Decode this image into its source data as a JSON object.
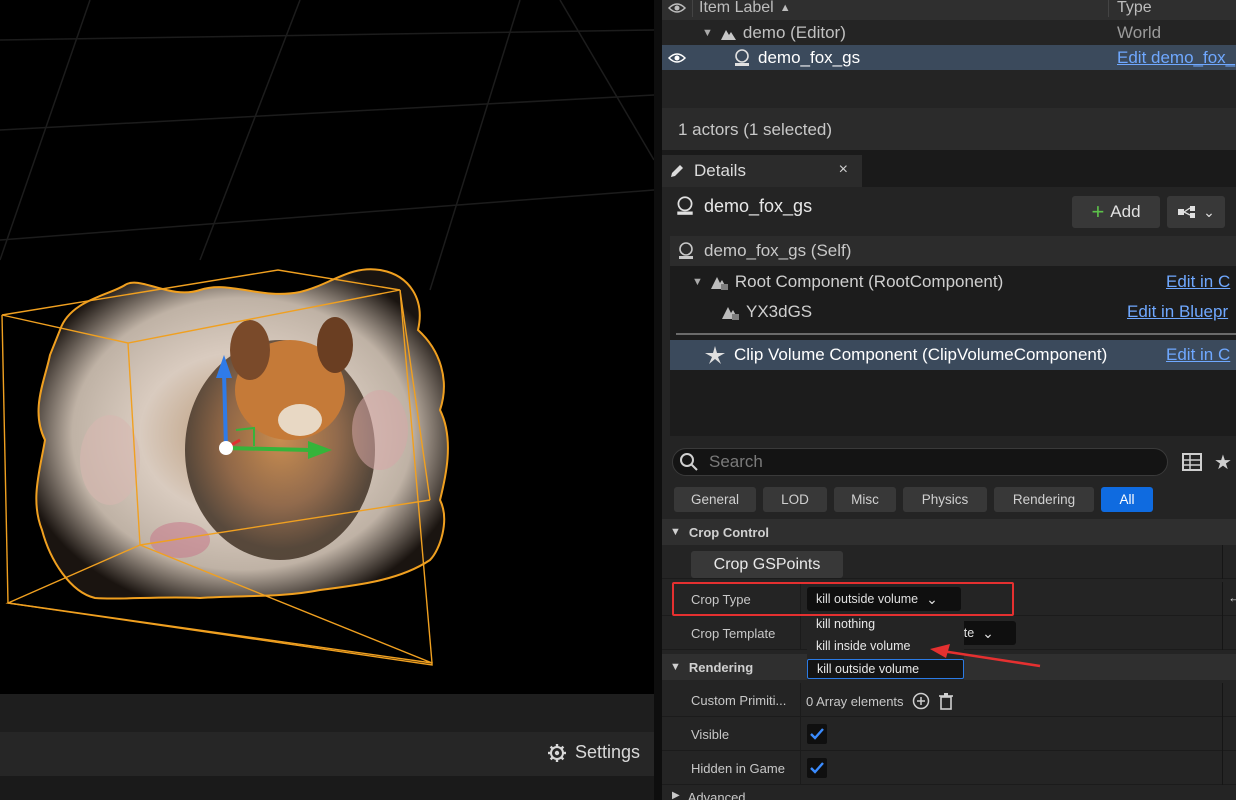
{
  "viewport": {
    "settings_label": "Settings"
  },
  "outliner": {
    "col_label": "Item Label",
    "sort_indicator": "▲",
    "col_type": "Type",
    "rows": [
      {
        "label": "demo (Editor)",
        "type": "World"
      },
      {
        "label": "demo_fox_gs",
        "type": "Edit demo_fox_"
      }
    ],
    "actors_count": "1 actors (1 selected)"
  },
  "details": {
    "tab_label": "Details",
    "close_glyph": "×",
    "actor_name": "demo_fox_gs",
    "add_label": "Add",
    "components": [
      {
        "label": "demo_fox_gs (Self)",
        "edit": ""
      },
      {
        "label": "Root Component (RootComponent)",
        "edit": "Edit in C"
      },
      {
        "label": "YX3dGS",
        "edit": "Edit in Bluepr"
      },
      {
        "label": "Clip Volume Component (ClipVolumeComponent)",
        "edit": "Edit in C"
      }
    ],
    "search_placeholder": "Search",
    "filters": [
      "General",
      "LOD",
      "Misc",
      "Physics",
      "Rendering",
      "All"
    ],
    "active_filter": "All",
    "sections": {
      "crop_control": "Crop Control",
      "rendering": "Rendering",
      "advanced": "Advanced"
    },
    "crop_button": "Crop GSPoints",
    "crop_type_label": "Crop Type",
    "crop_type_value": "kill outside volume",
    "crop_template_label": "Crop Template",
    "crop_template_value": "late",
    "dropdown_options": [
      "kill nothing",
      "kill inside volume",
      "kill outside volume"
    ],
    "custom_primitive_label": "Custom Primiti...",
    "custom_primitive_value": "0 Array elements",
    "visible_label": "Visible",
    "visible_checked": true,
    "hidden_label": "Hidden in Game",
    "hidden_checked": true
  },
  "colors": {
    "accent": "#0f6be0",
    "selection": "#3b4a5c",
    "highlight": "#e53030",
    "link": "#6fa8ff",
    "gizmo_box": "#f0a020"
  }
}
